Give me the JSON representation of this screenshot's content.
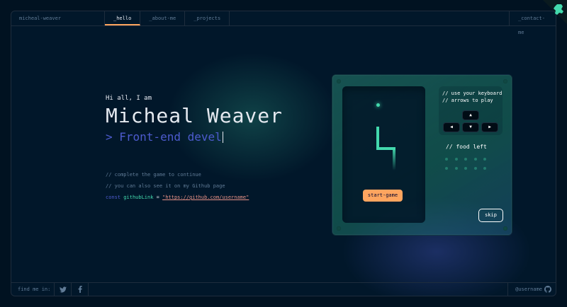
{
  "header": {
    "brand": "micheal-weaver",
    "tabs": [
      {
        "label": "_hello",
        "active": true
      },
      {
        "label": "_about-me",
        "active": false
      },
      {
        "label": "_projects",
        "active": false
      }
    ],
    "contact": "_contact-me"
  },
  "hero": {
    "greeting": "Hi all, I am",
    "name": "Micheal Weaver",
    "role": "> Front-end devel"
  },
  "comments": {
    "line1": "// complete the game to continue",
    "line2": "// you can also see it on my Github page",
    "code_keyword": "const",
    "code_var": "githubLink",
    "code_eq": "=",
    "code_link": "\"https://github.com/username\""
  },
  "game": {
    "start_label": "start-game",
    "instructions_line1": "// use your keyboard",
    "instructions_line2": "// arrows to play",
    "food_left_label": "// food left",
    "food_total": 10,
    "food_remaining": 10,
    "skip_label": "skip",
    "keys": {
      "up": "▲",
      "left": "◀",
      "down": "▼",
      "right": "▶"
    }
  },
  "footer": {
    "find_label": "find me in:",
    "social": [
      "twitter-icon",
      "facebook-icon"
    ],
    "github_user": "@username"
  },
  "colors": {
    "background": "#011221",
    "accent_orange": "#FEA55F",
    "accent_green": "#43D9AD",
    "accent_blue": "#4D5BCE",
    "link_pink": "#E99287"
  }
}
